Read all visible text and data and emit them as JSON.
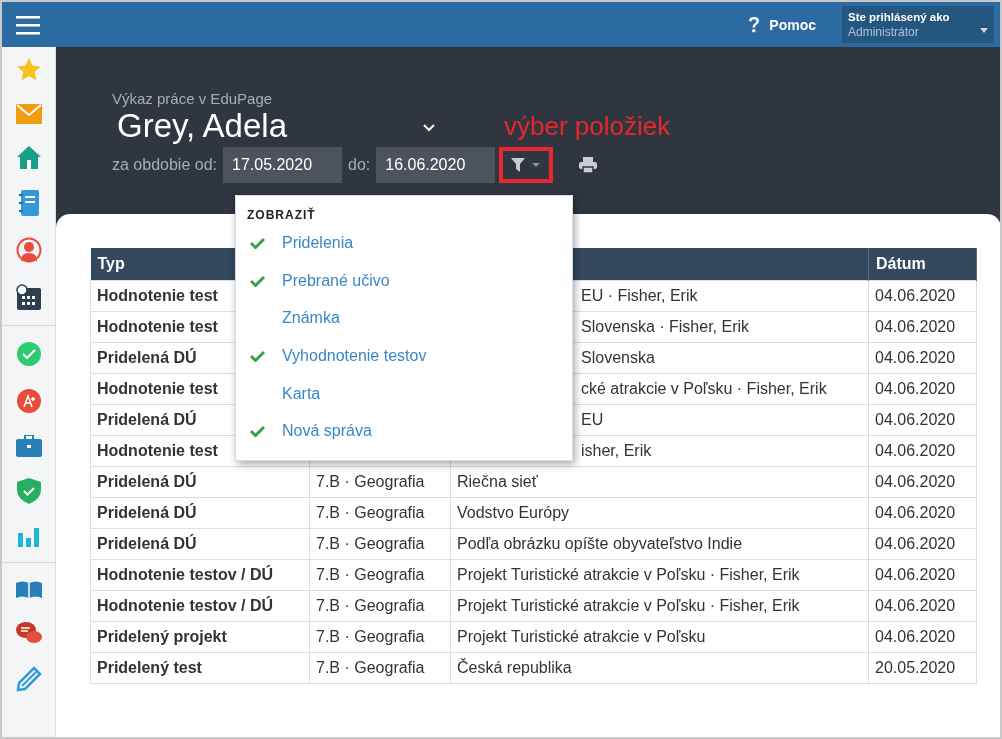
{
  "topbar": {
    "help": "Pomoc",
    "user_label": "Ste prihlásený ako",
    "user_role": "Administrátor"
  },
  "header": {
    "subtitle": "Výkaz práce v EduPage",
    "person": "Grey, Adela",
    "from_label": "za obdobie od:",
    "from": "17.05.2020",
    "to_label": "do:",
    "to": "16.06.2020",
    "annotation": "výber položiek"
  },
  "filter_menu": {
    "title": "ZOBRAZIŤ",
    "items": [
      {
        "label": "Pridelenia",
        "checked": true
      },
      {
        "label": "Prebrané učivo",
        "checked": true
      },
      {
        "label": "Známka",
        "checked": false
      },
      {
        "label": "Vyhodnotenie testov",
        "checked": true
      },
      {
        "label": "Karta",
        "checked": false
      },
      {
        "label": "Nová správa",
        "checked": true
      }
    ]
  },
  "table": {
    "columns": [
      "Typ",
      "Dátum"
    ],
    "rows": [
      {
        "type": "Hodnotenie test",
        "topic": "EU · Fisher, Erik",
        "date": "04.06.2020"
      },
      {
        "type": "Hodnotenie test",
        "topic": "Slovenska · Fisher, Erik",
        "date": "04.06.2020"
      },
      {
        "type": "Pridelená DÚ",
        "topic": "Slovenska",
        "date": "04.06.2020"
      },
      {
        "type": "Hodnotenie test",
        "topic": "cké atrakcie v Poľsku · Fisher, Erik",
        "date": "04.06.2020"
      },
      {
        "type": "Pridelená DÚ",
        "topic": "EU",
        "date": "04.06.2020"
      },
      {
        "type": "Hodnotenie test",
        "topic": "isher, Erik",
        "date": "04.06.2020"
      },
      {
        "type": "Pridelená DÚ",
        "class_subject": "7.B · Geografia",
        "topic": "Riečna sieť",
        "date": "04.06.2020"
      },
      {
        "type": "Pridelená DÚ",
        "class_subject": "7.B · Geografia",
        "topic": "Vodstvo Európy",
        "date": "04.06.2020"
      },
      {
        "type": "Pridelená DÚ",
        "class_subject": "7.B · Geografia",
        "topic": "Podľa obrázku opíšte obyvateľstvo Indie",
        "date": "04.06.2020"
      },
      {
        "type": "Hodnotenie testov / DÚ",
        "class_subject": "7.B · Geografia",
        "topic": "Projekt Turistické atrakcie v Poľsku · Fisher, Erik",
        "date": "04.06.2020"
      },
      {
        "type": "Hodnotenie testov / DÚ",
        "class_subject": "7.B · Geografia",
        "topic": "Projekt Turistické atrakcie v Poľsku · Fisher, Erik",
        "date": "04.06.2020"
      },
      {
        "type": "Pridelený projekt",
        "class_subject": "7.B · Geografia",
        "topic": "Projekt Turistické atrakcie v Poľsku",
        "date": "04.06.2020"
      },
      {
        "type": "Pridelený test",
        "class_subject": "7.B · Geografia",
        "topic": "Česká republika",
        "date": "20.05.2020"
      }
    ]
  }
}
